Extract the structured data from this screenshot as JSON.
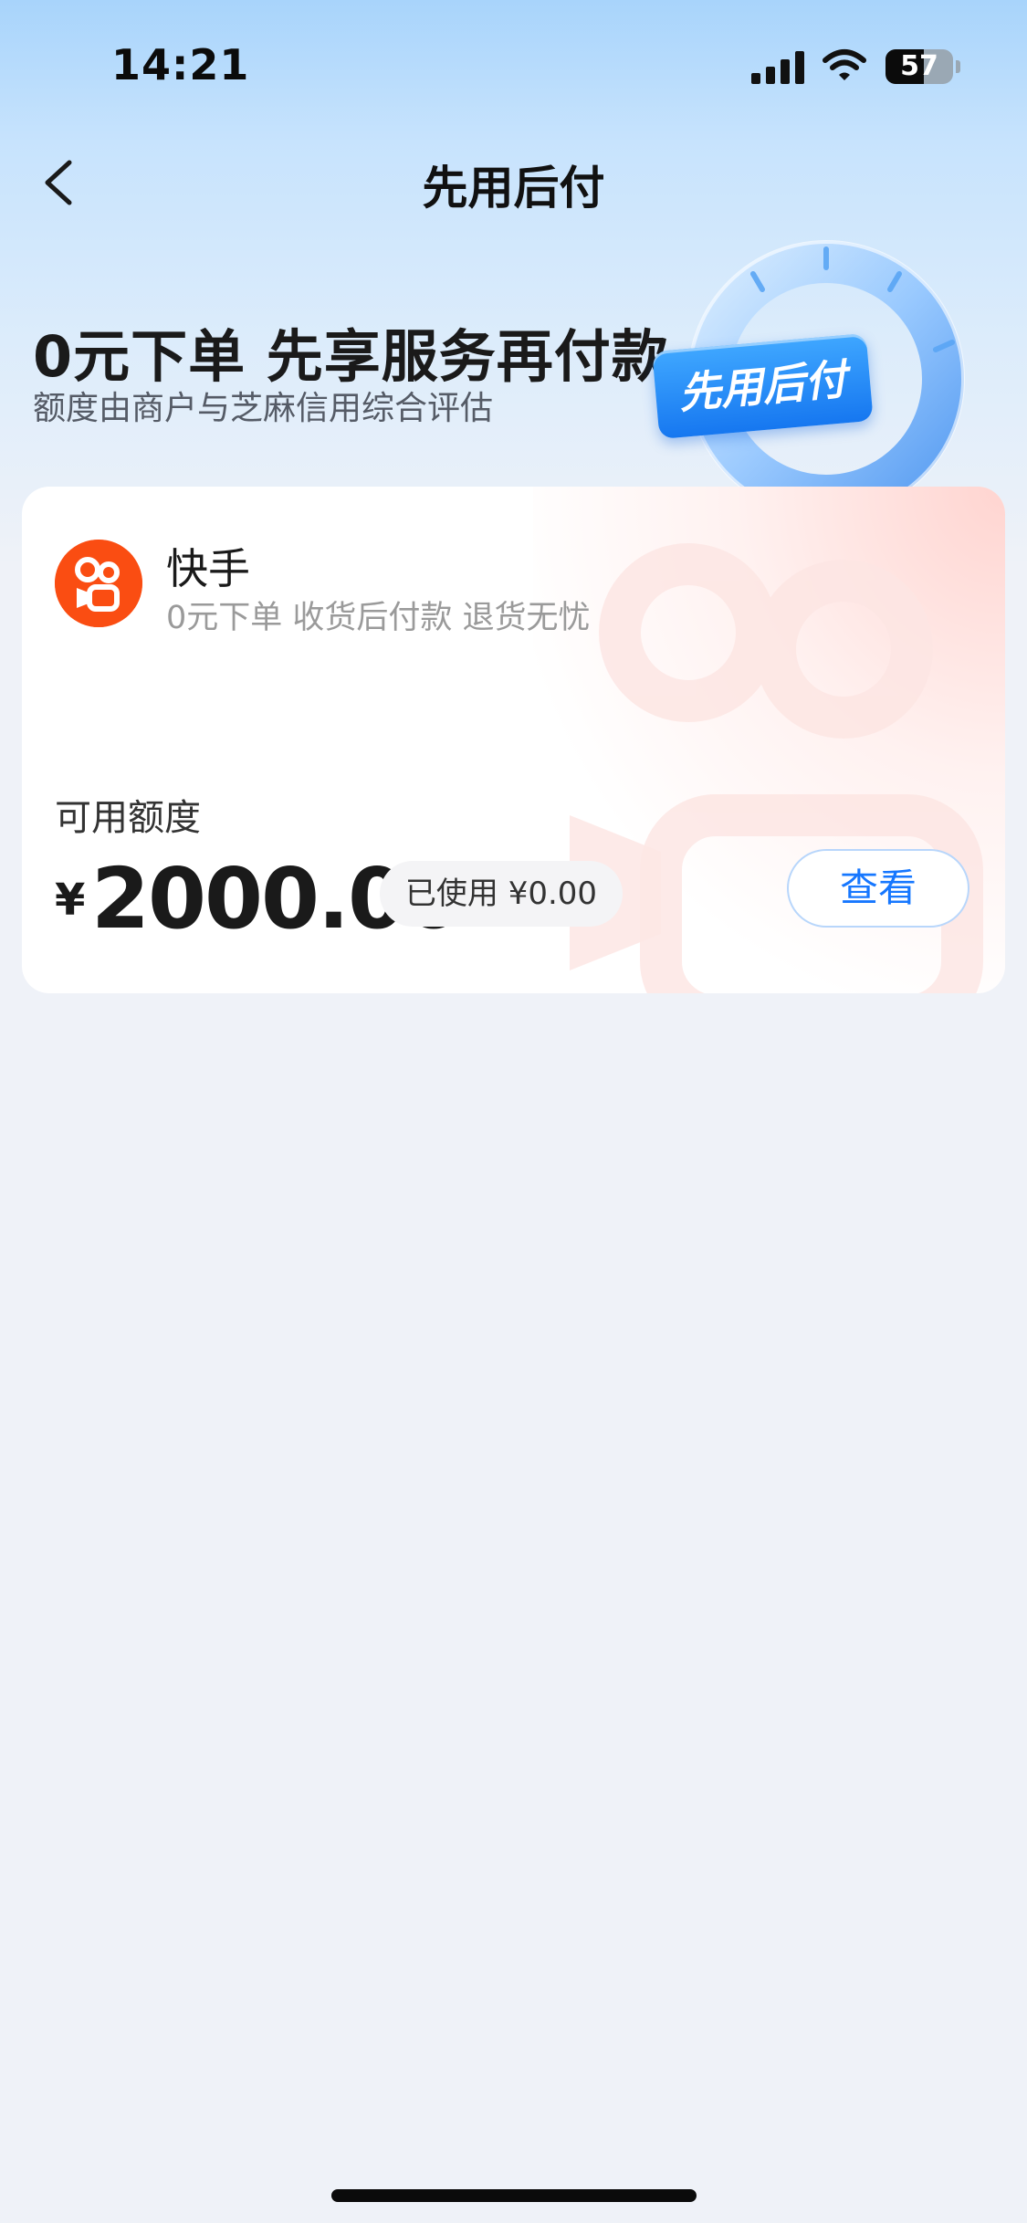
{
  "status_bar": {
    "time": "14:21",
    "battery": "57",
    "battery_level_percent": 57,
    "signal_icon": "cellular-signal-icon",
    "wifi_icon": "wifi-icon"
  },
  "header": {
    "back_icon": "chevron-left-icon",
    "title": "先用后付"
  },
  "hero": {
    "title": "0元下单 先享服务再付款",
    "subtitle": "额度由商户与芝麻信用综合评估",
    "badge_text": "先用后付"
  },
  "card": {
    "app_name": "快手",
    "app_desc": "0元下单 收货后付款 退货无忧",
    "app_logo_icon": "kuaishou-logo-icon",
    "quota_label": "可用额度",
    "currency": "¥",
    "amount": "2000.00",
    "used": "已使用 ¥0.00",
    "view_button": "查看"
  },
  "colors": {
    "brand_orange": "#fa4d12",
    "accent_blue": "#1677ff",
    "page_bg": "#eff2f8"
  }
}
